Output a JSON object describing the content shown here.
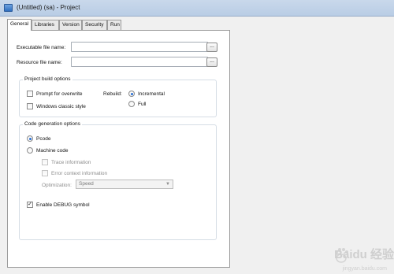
{
  "window": {
    "title": "(Untitled) (sa) - Project"
  },
  "tabs": [
    {
      "label": "General",
      "active": true
    },
    {
      "label": "Libraries",
      "active": false
    },
    {
      "label": "Version",
      "active": false
    },
    {
      "label": "Security",
      "active": false
    },
    {
      "label": "Run",
      "active": false
    }
  ],
  "general": {
    "executable_label": "Executable file name:",
    "executable_value": "",
    "resource_label": "Resource file name:",
    "resource_value": "",
    "browse_label": "...",
    "build_group": {
      "title": "Project build options",
      "prompt_overwrite": {
        "label": "Prompt for overwrite",
        "checked": false
      },
      "windows_classic": {
        "label": "Windows classic style",
        "checked": false
      },
      "rebuild_label": "Rebuild:",
      "incremental": {
        "label": "Incremental",
        "selected": true
      },
      "full": {
        "label": "Full",
        "selected": false
      }
    },
    "codegen_group": {
      "title": "Code generation options",
      "pcode": {
        "label": "Pcode",
        "selected": true
      },
      "machine_code": {
        "label": "Machine code",
        "selected": false
      },
      "trace_info": {
        "label": "Trace information",
        "checked": false,
        "enabled": false
      },
      "error_context": {
        "label": "Error context information",
        "checked": false,
        "enabled": false
      },
      "optimization_label": "Optimization:",
      "optimization_value": "Speed",
      "enable_debug": {
        "label": "Enable DEBUG symbol",
        "checked": true
      }
    }
  },
  "watermark": {
    "text": "Baidu 经验",
    "url": "jingyan.baidu.com"
  },
  "colors": {
    "accent_radio": "#2a6fd4",
    "titlebar": "#c9d8eb"
  }
}
